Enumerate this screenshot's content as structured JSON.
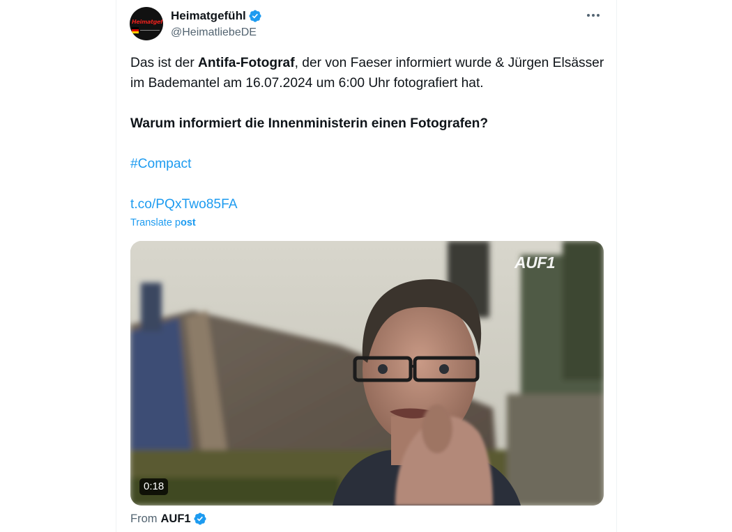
{
  "author": {
    "name": "Heimatgefühl",
    "handle": "@HeimatliebeDE",
    "avatar_text": "Heimatgefühl",
    "verified": true
  },
  "tweet": {
    "text_prefix": "Das ist der ",
    "text_bold": "Antifa-Fotograf",
    "text_suffix": ", der von Faeser informiert wurde & Jürgen Elsässer im Bademantel am 16.07.2024 um 6:00 Uhr fotografiert hat.",
    "question": "Warum informiert die Innenministerin einen Fotografen?",
    "hashtag": "#Compact",
    "link": "t.co/PQxTwo85FA"
  },
  "translate": {
    "prefix": "Translate p",
    "bold": "ost"
  },
  "media": {
    "watermark": "AUF1",
    "duration": "0:18"
  },
  "source": {
    "from_label": "From",
    "name": "AUF1"
  },
  "icons": {
    "more": "more-dots-icon",
    "verified": "verified-badge-icon"
  },
  "colors": {
    "link": "#1d9bf0",
    "verified": "#1d9bf0",
    "secondary_text": "#536471"
  }
}
